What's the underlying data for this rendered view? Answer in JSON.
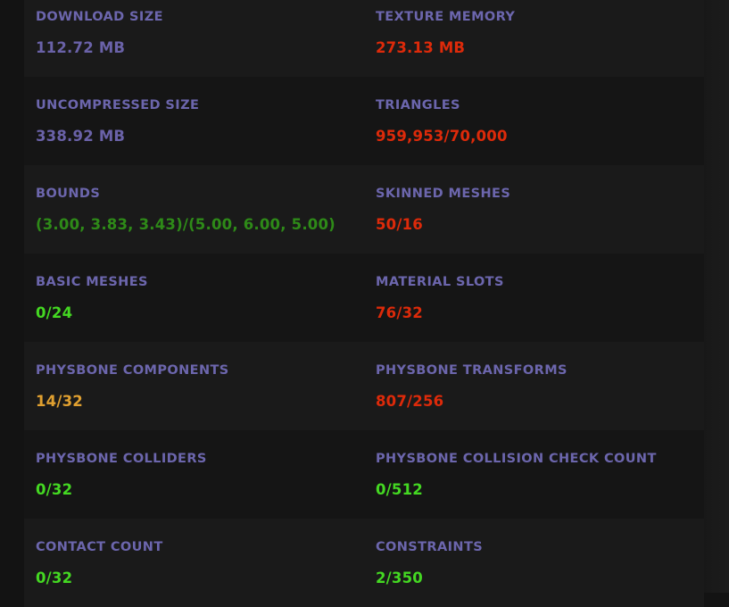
{
  "colors": {
    "label": "#6c66ad",
    "neutral": "#6a62a8",
    "good": "#44d822",
    "bounds": "#2e8a18",
    "warn": "#e0a030",
    "bad": "#dd2a0a"
  },
  "rows": [
    [
      {
        "label": "DOWNLOAD SIZE",
        "value": "112.72 MB",
        "status": "neutral"
      },
      {
        "label": "TEXTURE MEMORY",
        "value": "273.13 MB",
        "status": "bad"
      }
    ],
    [
      {
        "label": "UNCOMPRESSED SIZE",
        "value": "338.92 MB",
        "status": "neutral"
      },
      {
        "label": "TRIANGLES",
        "value": "959,953/70,000",
        "status": "bad"
      }
    ],
    [
      {
        "label": "BOUNDS",
        "value": "(3.00, 3.83, 3.43)/(5.00, 6.00, 5.00)",
        "status": "bounds"
      },
      {
        "label": "SKINNED MESHES",
        "value": "50/16",
        "status": "bad"
      }
    ],
    [
      {
        "label": "BASIC MESHES",
        "value": "0/24",
        "status": "good"
      },
      {
        "label": "MATERIAL SLOTS",
        "value": "76/32",
        "status": "bad"
      }
    ],
    [
      {
        "label": "PHYSBONE COMPONENTS",
        "value": "14/32",
        "status": "warn"
      },
      {
        "label": "PHYSBONE TRANSFORMS",
        "value": "807/256",
        "status": "bad"
      }
    ],
    [
      {
        "label": "PHYSBONE COLLIDERS",
        "value": "0/32",
        "status": "good"
      },
      {
        "label": "PHYSBONE COLLISION CHECK COUNT",
        "value": "0/512",
        "status": "good"
      }
    ],
    [
      {
        "label": "CONTACT COUNT",
        "value": "0/32",
        "status": "good"
      },
      {
        "label": "CONSTRAINTS",
        "value": "2/350",
        "status": "good"
      }
    ]
  ]
}
